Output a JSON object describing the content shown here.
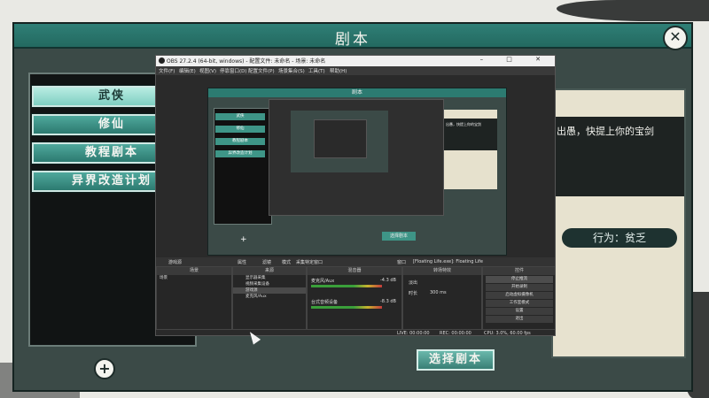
{
  "game": {
    "title": "剧本",
    "close_icon": "close-icon",
    "left_buttons": [
      "武侠",
      "修仙",
      "教程剧本",
      "异界改造计划"
    ],
    "add_icon": "plus-icon",
    "script_line": "出愚，快提上你的宝剑",
    "action_label": "行为：贫乏",
    "select_button": "选择剧本"
  },
  "obs": {
    "title": "OBS 27.2.4 (64-bit, windows) - 配置文件: 未命名 - 场景: 未命名",
    "window_controls": "– □ ✕",
    "menu": [
      "文件(F)",
      "编辑(E)",
      "视图(V)",
      "停靠窗口(D)",
      "配置文件(P)",
      "场景集合(S)",
      "工具(T)",
      "帮助(H)"
    ],
    "nested": {
      "title": "剧本",
      "buttons": [
        "武侠",
        "修仙",
        "教程剧本",
        "异界改造计划"
      ],
      "right_text": "出愚，快提上你的宝剑",
      "select": "选择剧本",
      "plus": "+"
    },
    "source_bar": {
      "left": "游戏源",
      "props": "属性",
      "filters": "滤镜",
      "mode": "模式",
      "mode_value": "采集特定窗口",
      "window": "窗口",
      "window_value": "[Floating Life.exe]: Floating Life"
    },
    "docks": {
      "scenes": {
        "header": "场景",
        "items": [
          "场景"
        ]
      },
      "sources": {
        "header": "来源",
        "items": [
          "显示器采集",
          "视频采集设备",
          "游戏源",
          "麦克风/Aux"
        ]
      },
      "mixer": {
        "header": "混音器",
        "channels": [
          {
            "name": "麦克风/Aux",
            "db": "-4.3 dB"
          },
          {
            "name": "台式音频设备",
            "db": "-8.3 dB"
          }
        ]
      },
      "transitions": {
        "header": "转场特效",
        "type": "淡出",
        "duration_label": "时长",
        "duration": "300 ms"
      },
      "controls": {
        "header": "控件",
        "buttons": [
          "停止推流",
          "开始录制",
          "启动虚拟摄像机",
          "工作室模式",
          "设置",
          "退出"
        ]
      }
    },
    "status": {
      "live": "LIVE: 00:00:00",
      "rec": "REC: 00:00:00",
      "cpu": "CPU: 3.0%, 60.00 fps"
    }
  }
}
